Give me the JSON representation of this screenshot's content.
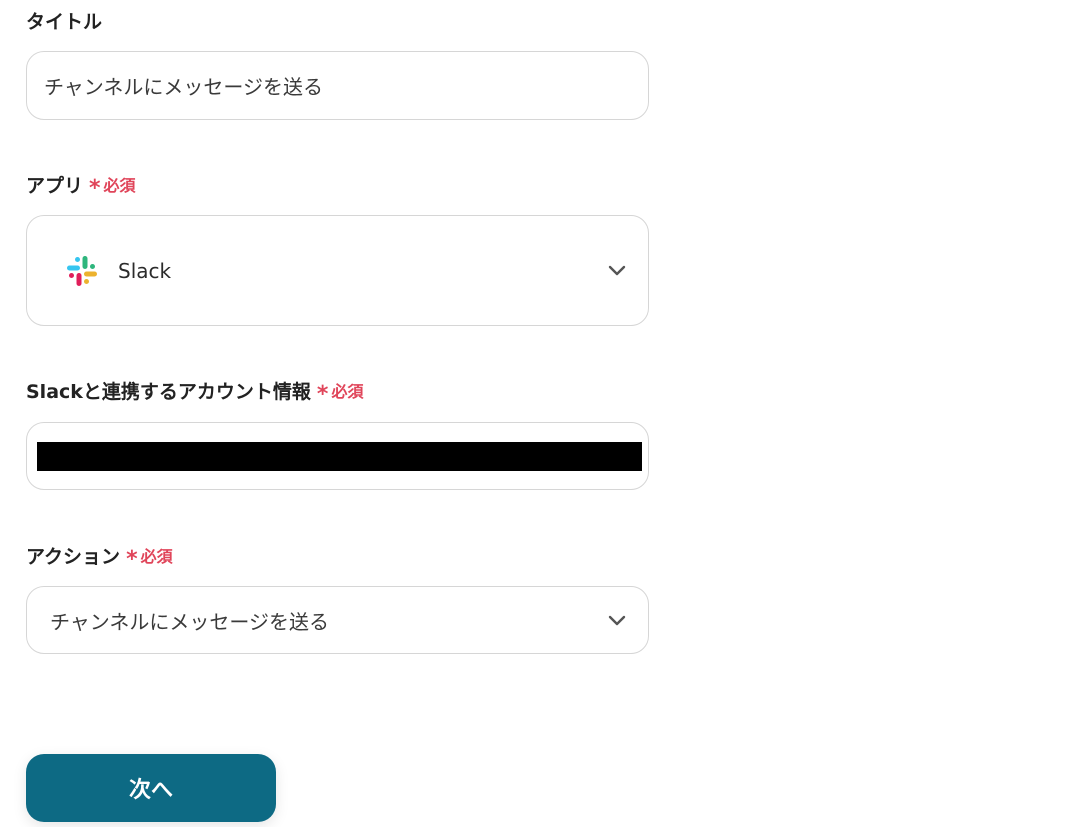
{
  "title_field": {
    "label": "タイトル",
    "value": "チャンネルにメッセージを送る"
  },
  "app_field": {
    "label": "アプリ",
    "required_mark": "*",
    "required_text": "必須",
    "selected_app": "Slack",
    "app_icon": "slack-logo-icon"
  },
  "account_field": {
    "label": "Slackと連携するアカウント情報",
    "required_mark": "*",
    "required_text": "必須",
    "value_redacted": true
  },
  "action_field": {
    "label": "アクション",
    "required_mark": "*",
    "required_text": "必須",
    "selected_action": "チャンネルにメッセージを送る"
  },
  "next_button": {
    "label": "次へ"
  },
  "colors": {
    "primary_button": "#0d6a84",
    "required": "#e0455a",
    "border": "#d6d6d6"
  }
}
